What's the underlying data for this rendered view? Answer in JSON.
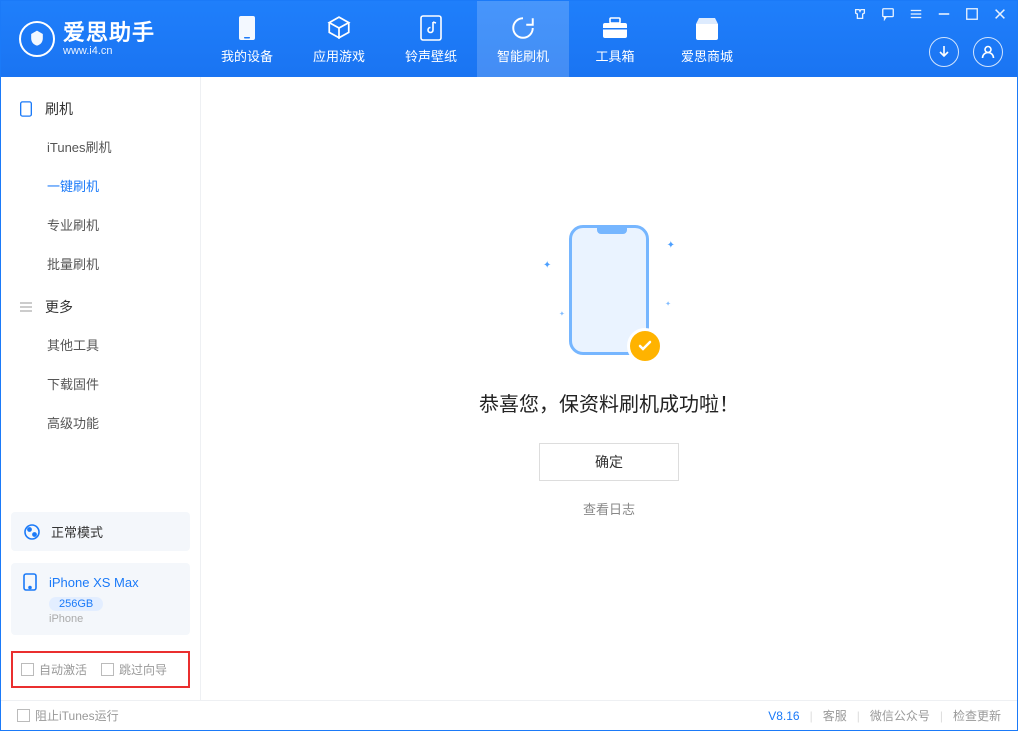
{
  "app": {
    "title": "爱思助手",
    "subtitle": "www.i4.cn"
  },
  "nav": {
    "tabs": [
      {
        "label": "我的设备"
      },
      {
        "label": "应用游戏"
      },
      {
        "label": "铃声壁纸"
      },
      {
        "label": "智能刷机"
      },
      {
        "label": "工具箱"
      },
      {
        "label": "爱思商城"
      }
    ]
  },
  "sidebar": {
    "flash": {
      "header": "刷机",
      "items": [
        {
          "label": "iTunes刷机"
        },
        {
          "label": "一键刷机"
        },
        {
          "label": "专业刷机"
        },
        {
          "label": "批量刷机"
        }
      ]
    },
    "more": {
      "header": "更多",
      "items": [
        {
          "label": "其他工具"
        },
        {
          "label": "下载固件"
        },
        {
          "label": "高级功能"
        }
      ]
    },
    "mode_card": {
      "label": "正常模式"
    },
    "device_card": {
      "name": "iPhone XS Max",
      "storage": "256GB",
      "type": "iPhone"
    },
    "checkboxes": {
      "auto_activate": "自动激活",
      "skip_guide": "跳过向导"
    }
  },
  "main": {
    "success_msg": "恭喜您，保资料刷机成功啦！",
    "ok_btn": "确定",
    "view_log": "查看日志"
  },
  "footer": {
    "block_itunes": "阻止iTunes运行",
    "version": "V8.16",
    "links": {
      "support": "客服",
      "wechat": "微信公众号",
      "update": "检查更新"
    }
  }
}
